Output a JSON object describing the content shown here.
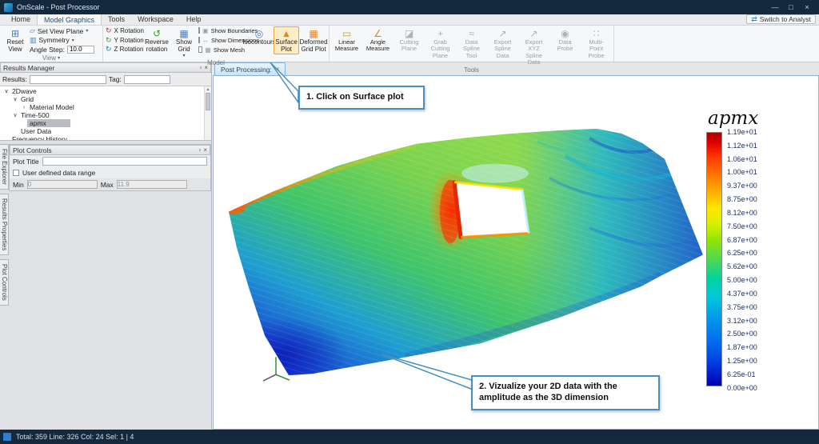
{
  "window": {
    "title": "OnScale - Post Processor",
    "switch_to_analyst": "Switch to Analyst"
  },
  "menu_tabs": [
    {
      "label": "Home",
      "active": false
    },
    {
      "label": "Model Graphics",
      "active": true
    },
    {
      "label": "Tools",
      "active": false
    },
    {
      "label": "Workspace",
      "active": false
    },
    {
      "label": "Help",
      "active": false
    }
  ],
  "ribbon": {
    "groups": {
      "view": "View",
      "model": "Model",
      "tools": "Tools"
    },
    "view": {
      "reset_view": "Reset View",
      "set_view_plane": "Set View Plane",
      "symmetry": "Symmetry",
      "angle_step_label": "Angle Step:",
      "angle_step_value": "10.0"
    },
    "model": {
      "x_rotation": "X Rotation",
      "y_rotation": "Y Rotation",
      "z_rotation": "Z Rotation",
      "reverse_rotation": "Reverse rotation",
      "show_grid": "Show Grid",
      "show_boundaries": "Show Boundaries",
      "show_dimensions": "Show Dimensions",
      "show_mesh": "Show Mesh",
      "isocontours": "Isocontours",
      "surface_plot": "Surface Plot",
      "deformed_grid_plot": "Deformed Grid Plot"
    },
    "tools": {
      "linear_measure": "Linear Measure",
      "angle_measure": "Angle Measure",
      "cutting_plane": "Cutting Plane",
      "grab_cutting_plane": "Grab Cutting Plane",
      "data_spline_tool": "Data Spline Tool",
      "export_spline_data": "Export Spline Data",
      "export_xyz_spline_data": "Export XYZ Spline Data",
      "data_probe": "Data Probe",
      "multi_point_probe": "Multi-Point Probe"
    }
  },
  "results_manager": {
    "title": "Results Manager",
    "results_label": "Results:",
    "tag_label": "Tag:",
    "tree": [
      {
        "label": "2Dwave",
        "level": 0,
        "caret": "open",
        "selected": false
      },
      {
        "label": "Grid",
        "level": 1,
        "caret": "open",
        "selected": false
      },
      {
        "label": "Material Model",
        "level": 2,
        "caret": "closed",
        "selected": false
      },
      {
        "label": "Time-500",
        "level": 1,
        "caret": "open",
        "selected": false
      },
      {
        "label": "apmx",
        "level": 2,
        "caret": null,
        "selected": true
      },
      {
        "label": "User Data",
        "level": 1,
        "caret": null,
        "selected": false
      },
      {
        "label": "Frequency History",
        "level": 0,
        "caret": null,
        "selected": false
      }
    ]
  },
  "plot_controls": {
    "title": "Plot Controls",
    "plot_title_label": "Plot Title",
    "plot_title_value": "",
    "user_defined_range_label": "User defined data range",
    "min_label": "Min",
    "min_value": "0",
    "max_label": "Max",
    "max_value": "11.9"
  },
  "side_tabs": [
    "File Explorer",
    "Results Properties",
    "Plot Controls"
  ],
  "viewport": {
    "tab_label": "Post Processing:",
    "legend_title": "apmx",
    "legend_values": [
      "1.19e+01",
      "1.12e+01",
      "1.06e+01",
      "1.00e+01",
      "9.37e+00",
      "8.75e+00",
      "8.12e+00",
      "7.50e+00",
      "6.87e+00",
      "6.25e+00",
      "5.62e+00",
      "5.00e+00",
      "4.37e+00",
      "3.75e+00",
      "3.12e+00",
      "2.50e+00",
      "1.87e+00",
      "1.25e+00",
      "6.25e-01",
      "0.00e+00"
    ]
  },
  "callouts": {
    "callout1": "1. Click on Surface plot",
    "callout2": "2. Vizualize your 2D data with the amplitude as the 3D dimension"
  },
  "status_bar": {
    "text": "Total: 359 Line: 326 Col: 24 Sel: 1 | 4"
  },
  "icons": {
    "caret_down": "▾",
    "close": "×",
    "minimize": "—",
    "maximize": "□",
    "float": "▫",
    "tree_open": "∨",
    "tree_closed": "›",
    "switch_analyst": "⇄",
    "reset_view": "⊞",
    "view_plane": "▱",
    "symmetry": "▥",
    "rotation": "↻",
    "reverse_rotation": "↺",
    "show_grid": "▦",
    "boundaries": "▣",
    "dimensions": "↔",
    "mesh": "▦",
    "isocontours": "◎",
    "surface_plot": "▲",
    "deformed_grid": "▦",
    "linear_measure": "▭",
    "angle_measure": "∠",
    "cutting_plane": "◪",
    "grab_cutting_plane": "+",
    "data_spline": "≈",
    "export_spline": "↗",
    "export_xyz": "↗",
    "data_probe": "◉",
    "multi_point_probe": "∷",
    "scroll_up": "▴",
    "scroll_down": "▾"
  }
}
